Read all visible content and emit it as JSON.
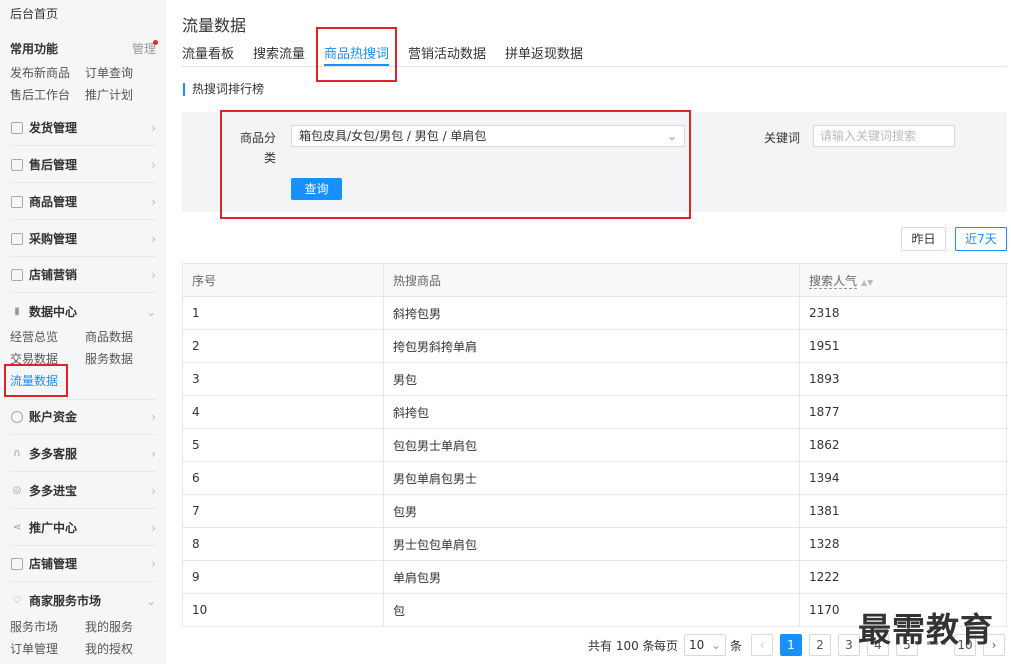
{
  "sidebar": {
    "home": "后台首页",
    "common_title": "常用功能",
    "manage": "管理",
    "common_links": [
      "发布新商品",
      "订单查询",
      "售后工作台",
      "推广计划"
    ],
    "menus": [
      {
        "label": "发货管理",
        "icon": "document-icon"
      },
      {
        "label": "售后管理",
        "icon": "shield-check-icon"
      },
      {
        "label": "商品管理",
        "icon": "bag-icon"
      },
      {
        "label": "采购管理",
        "icon": "list-icon"
      },
      {
        "label": "店铺营销",
        "icon": "calendar-icon"
      },
      {
        "label": "数据中心",
        "icon": "bar-chart-icon"
      },
      {
        "label": "账户资金",
        "icon": "coin-icon"
      },
      {
        "label": "多多客服",
        "icon": "headset-icon"
      },
      {
        "label": "多多进宝",
        "icon": "treasure-icon"
      },
      {
        "label": "推广中心",
        "icon": "share-icon"
      },
      {
        "label": "店铺管理",
        "icon": "store-icon"
      },
      {
        "label": "商家服务市场",
        "icon": "heart-icon"
      }
    ],
    "data_center_links": [
      "经营总览",
      "商品数据",
      "交易数据",
      "服务数据",
      "流量数据"
    ],
    "service_links": [
      "服务市场",
      "我的服务",
      "订单管理",
      "我的授权"
    ]
  },
  "page": {
    "title": "流量数据",
    "tabs": [
      "流量看板",
      "搜索流量",
      "商品热搜词",
      "营销活动数据",
      "拼单返现数据"
    ],
    "section_title": "热搜词排行榜"
  },
  "filter": {
    "category_label_1": "商品分",
    "category_label_2": "类",
    "category_value": "箱包皮具/女包/男包 / 男包 / 单肩包",
    "keyword_label": "关键词",
    "keyword_placeholder": "请输入关键词搜索",
    "query_button": "查询"
  },
  "range": {
    "yesterday": "昨日",
    "last7": "近7天"
  },
  "table": {
    "headers": [
      "序号",
      "热搜商品",
      "搜索人气"
    ],
    "rows": [
      [
        "1",
        "斜挎包男",
        "2318"
      ],
      [
        "2",
        "挎包男斜挎单肩",
        "1951"
      ],
      [
        "3",
        "男包",
        "1893"
      ],
      [
        "4",
        "斜挎包",
        "1877"
      ],
      [
        "5",
        "包包男士单肩包",
        "1862"
      ],
      [
        "6",
        "男包单肩包男士",
        "1394"
      ],
      [
        "7",
        "包男",
        "1381"
      ],
      [
        "8",
        "男士包包单肩包",
        "1328"
      ],
      [
        "9",
        "单肩包男",
        "1222"
      ],
      [
        "10",
        "包",
        "1170"
      ]
    ]
  },
  "pagination": {
    "total_text": "共有 100 条",
    "per_page_label": "每页",
    "page_size": "10",
    "unit": "条",
    "pages": [
      "1",
      "2",
      "3",
      "4",
      "5"
    ],
    "ellipsis": "•••",
    "last_page": "10"
  },
  "watermark": "最需教育",
  "colors": {
    "accent": "#1890ff",
    "highlight": "#e0232b"
  }
}
